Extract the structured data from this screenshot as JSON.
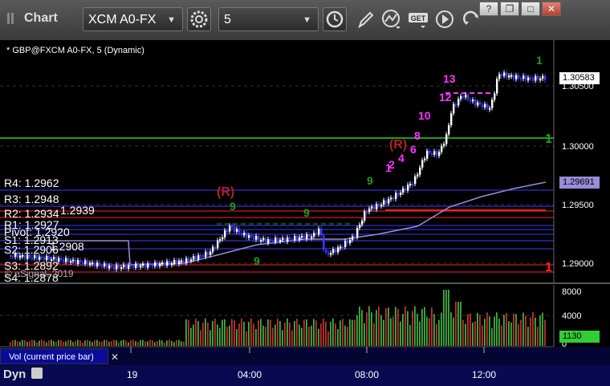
{
  "window": {
    "title": "Chart",
    "controls": [
      "?",
      "❐",
      "□",
      "✕"
    ]
  },
  "toolbar": {
    "symbol": "XCM A0-FX",
    "interval": "5",
    "get_label": "GET"
  },
  "chart": {
    "symbol_label": "* GBP@FXCM A0-FX, 5 (Dynamic)",
    "copyright": "© eSignal, 2019",
    "last_price": "1.30583",
    "ma_price": "1.29691",
    "volume_value": "1130",
    "price_axis": [
      "1.30500",
      "1.30000",
      "1.29500",
      "1.29000"
    ],
    "volume_axis": [
      "8000",
      "4000",
      "0"
    ],
    "time_axis": [
      "19",
      "04:00",
      "08:00",
      "12:00"
    ],
    "pivot_labels": [
      {
        "text": "R4: 1.2962",
        "color": "#ffffff"
      },
      {
        "text": "R3: 1.2948",
        "color": "#ffffff"
      },
      {
        "text": "R2: 1.2934",
        "color": "#ffffff"
      },
      {
        "text": "1.2939",
        "color": "#ffffff"
      },
      {
        "text": "R1: 1.2927",
        "color": "#ffffff"
      },
      {
        "text": "Pivot: 1.2920",
        "color": "#ffffff"
      },
      {
        "text": "S1: 1.2913",
        "color": "#ffffff"
      },
      {
        "text": "S2: 1.2906",
        "color": "#ffffff"
      },
      {
        "text": "1.2908",
        "color": "#ffffff"
      },
      {
        "text": "S3: 1.2892",
        "color": "#ffffff"
      },
      {
        "text": "S4: 1.2878",
        "color": "#ffffff"
      }
    ],
    "td_labels": {
      "r_top": "(R)",
      "r_mid": "(R)",
      "nine_up": "9",
      "nine_dn": "9",
      "nine_a": "9",
      "nine_b": "9",
      "seq": [
        "1",
        "2",
        "4",
        "6",
        "8",
        "10",
        "12",
        "13"
      ],
      "one_top": "1",
      "one_mid": "1",
      "one_red": "1"
    },
    "indicator_tab": "Vol (current price bar)",
    "dyn_label": "Dyn",
    "colors": {
      "magenta": "#ff33ff",
      "green_line": "#1f9e1f",
      "red_line": "#ff2020",
      "blue_line": "#3b3bff",
      "ma": "#9a8cd8",
      "price_box": "#ffffff",
      "volume_box": "#33cc33"
    }
  }
}
